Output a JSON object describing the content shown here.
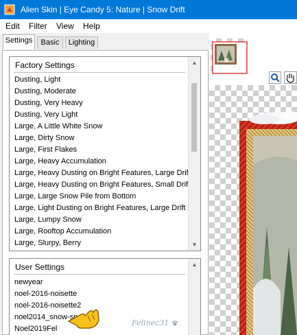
{
  "window": {
    "title": "Alien Skin | Eye Candy 5: Nature | Snow Drift"
  },
  "menu": [
    "Edit",
    "Filter",
    "View",
    "Help"
  ],
  "tabs": [
    "Settings",
    "Basic",
    "Lighting"
  ],
  "factory_settings": {
    "header": "Factory Settings",
    "items": [
      "Dusting, Light",
      "Dusting, Moderate",
      "Dusting, Very Heavy",
      "Dusting, Very Light",
      "Large, A Little White Snow",
      "Large, Dirty Snow",
      "Large, First Flakes",
      "Large, Heavy Accumulation",
      "Large, Heavy Dusting on Bright Features, Large Drift",
      "Large, Heavy Dusting on Bright Features, Small Drift",
      "Large, Large Snow Pile from Bottom",
      "Large, Light Dusting on Bright Features, Large Drift",
      "Large, Lumpy Snow",
      "Large, Rooftop Accumulation",
      "Large, Slurpy, Berry"
    ]
  },
  "user_settings": {
    "header": "User Settings",
    "items": [
      "newyear",
      "noel-2016-noisette",
      "noel-2016-noisette2",
      "noel2014_snow-sp",
      "Noel2019Fel"
    ]
  },
  "watermark": "Felinec31"
}
